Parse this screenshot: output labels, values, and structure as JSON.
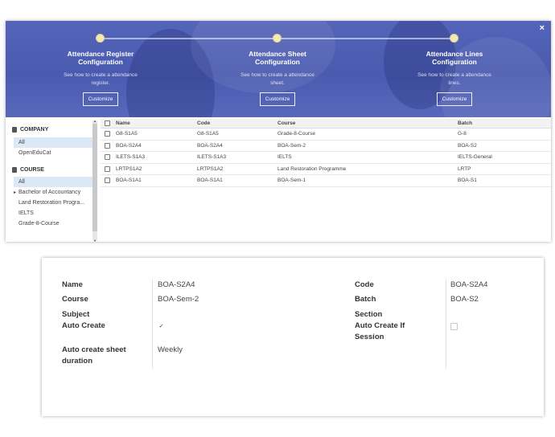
{
  "colors": {
    "banner": "#4f5fb3",
    "step_dot": "#f4eab8",
    "active_row": "#dbe8f5"
  },
  "wizard": {
    "close_icon": "×",
    "steps": [
      {
        "title_line1": "Attendance Register",
        "title_line2": "Configuration",
        "desc_line1": "See how to create a attendance",
        "desc_line2": "register.",
        "button": "Customize"
      },
      {
        "title_line1": "Attendance Sheet",
        "title_line2": "Configuration",
        "desc_line1": "See how to create a attendance",
        "desc_line2": "sheet.",
        "button": "Customize"
      },
      {
        "title_line1": "Attendance Lines",
        "title_line2": "Configuration",
        "desc_line1": "See how to create a attendance",
        "desc_line2": "lines.",
        "button": "Customize"
      }
    ]
  },
  "sidebar": {
    "company": {
      "title": "COMPANY",
      "icon": "building-icon",
      "items": [
        "All",
        "OpenEduCat"
      ]
    },
    "course": {
      "title": "COURSE",
      "icon": "book-icon",
      "items": [
        "All",
        "Bachelor of Accountancy",
        "Land Restoration Progra...",
        "IELTS",
        "Grade-8-Course"
      ]
    }
  },
  "table": {
    "columns": [
      "Name",
      "Code",
      "Course",
      "Batch"
    ],
    "rows": [
      [
        "G8-S1A5",
        "G8-S1A5",
        "Grade-8-Course",
        "G-8"
      ],
      [
        "BOA-S2A4",
        "BOA-S2A4",
        "BOA-Sem-2",
        "BOA-S2"
      ],
      [
        "ILETS-S1A3",
        "ILETS-S1A3",
        "IELTS",
        "IELTS-General"
      ],
      [
        "LRTPS1A2",
        "LRTPS1A2",
        "Land Restoration Programme",
        "LRTP"
      ],
      [
        "BOA-S1A1",
        "BOA-S1A1",
        "BOA-Sem-1",
        "BOA-S1"
      ]
    ]
  },
  "form": {
    "name_label": "Name",
    "name_value": "BOA-S2A4",
    "course_label": "Course",
    "course_value": "BOA-Sem-2",
    "subject_label": "Subject",
    "auto_create_label": "Auto Create",
    "auto_create_checked": "✓",
    "auto_duration_label_1": "Auto create sheet",
    "auto_duration_label_2": "duration",
    "auto_duration_value": "Weekly",
    "code_label": "Code",
    "code_value": "BOA-S2A4",
    "batch_label": "Batch",
    "batch_value": "BOA-S2",
    "section_label": "Section",
    "auto_session_label_1": "Auto Create If",
    "auto_session_label_2": "Session"
  }
}
